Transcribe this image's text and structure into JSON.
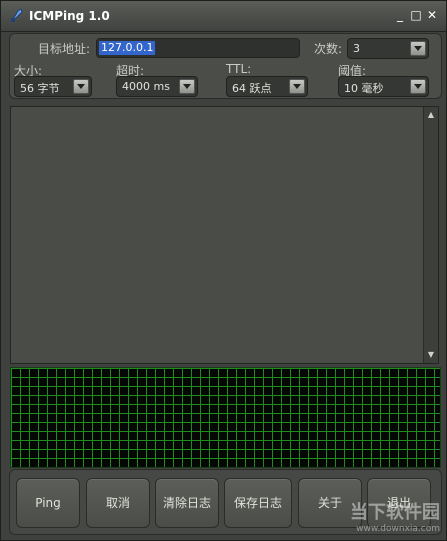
{
  "window": {
    "title": "ICMPing 1.0",
    "controls": {
      "minimize": "_",
      "maximize": "□",
      "close": "✕"
    }
  },
  "form": {
    "target": {
      "label": "目标地址:",
      "value": "127.0.0.1"
    },
    "count": {
      "label": "次数:",
      "value": "3"
    },
    "size": {
      "label": "大小:",
      "value": "56 字节"
    },
    "timeout": {
      "label": "超时:",
      "value": "4000 ms"
    },
    "ttl": {
      "label": "TTL:",
      "value": "64 跃点"
    },
    "threshold": {
      "label": "阈值:",
      "value": "10 毫秒"
    }
  },
  "buttons": {
    "ping": "Ping",
    "cancel": "取消",
    "clear_log": "清除日志",
    "save_log": "保存日志",
    "about": "关于",
    "exit": "退出"
  },
  "watermark": {
    "main": "当下软件园",
    "url": "www.downxia.com"
  },
  "colors": {
    "graph_grid": "#1f8c1f",
    "graph_bg": "#050805",
    "selection": "#3366cc"
  }
}
